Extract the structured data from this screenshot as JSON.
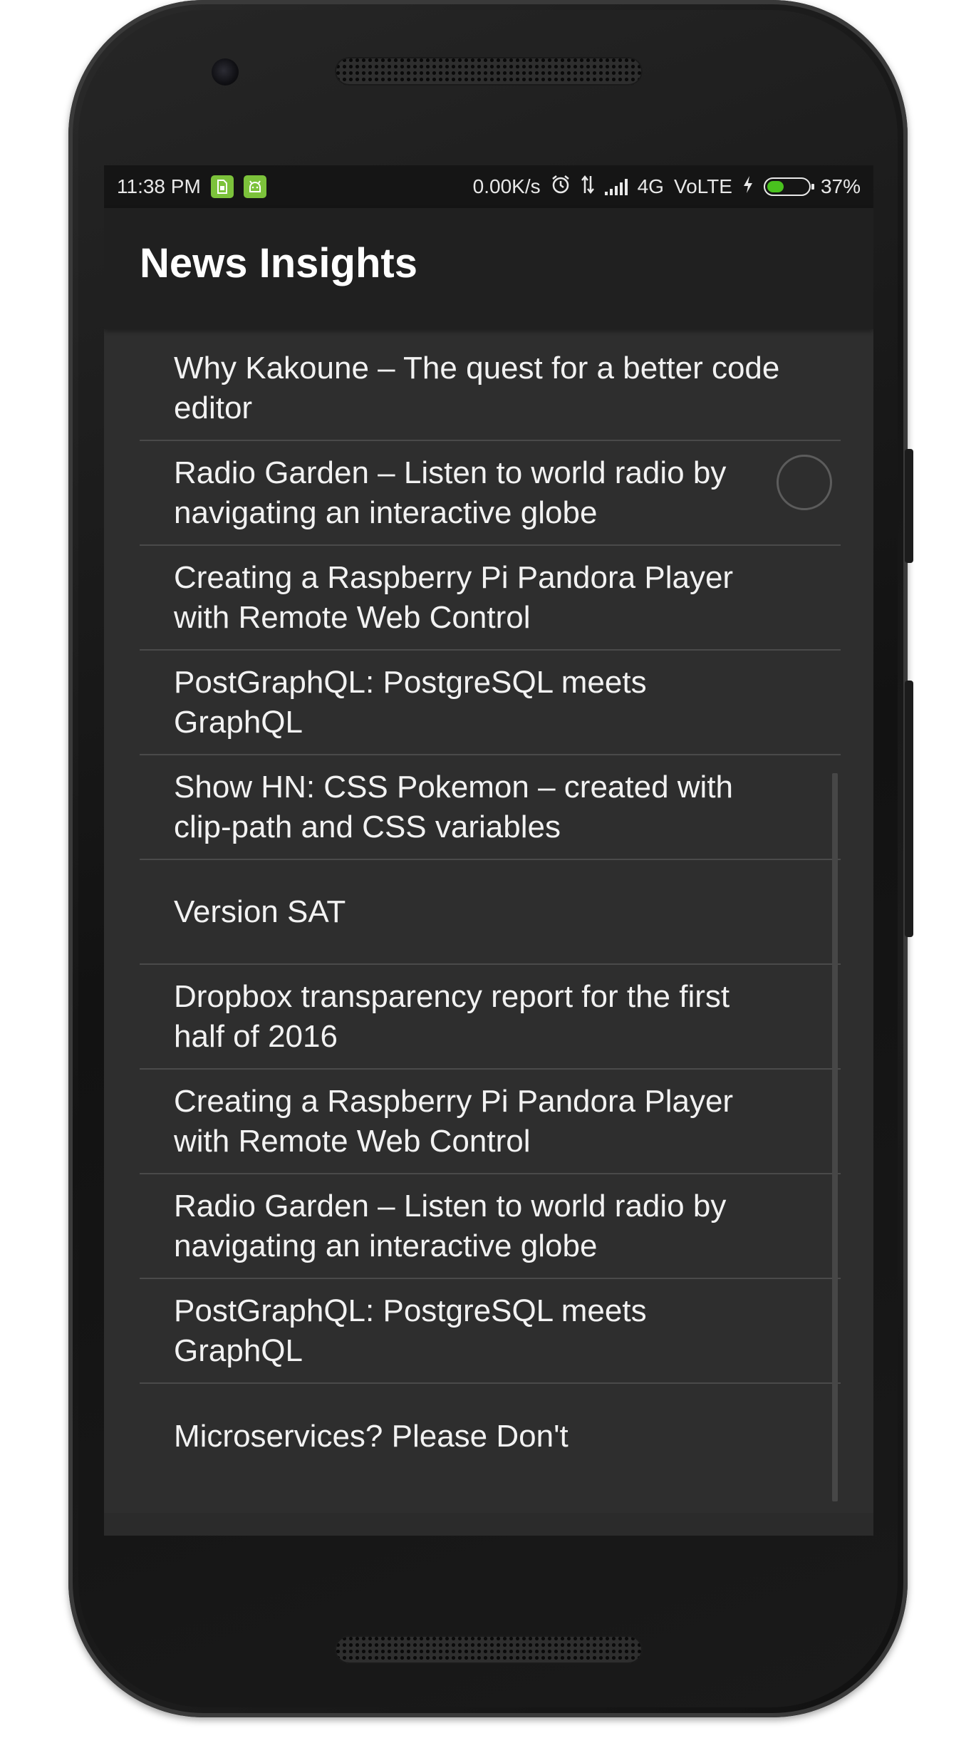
{
  "status_bar": {
    "time": "11:38 PM",
    "network_speed": "0.00K/s",
    "network_type": "4G",
    "volte": "VoLTE",
    "battery_percent": "37%",
    "battery_level": 0.37,
    "notification_icons": [
      "sim-card-icon",
      "android-icon"
    ],
    "status_icons": [
      "alarm-icon",
      "data-transfer-icon",
      "signal-icon",
      "charging-icon",
      "battery-icon"
    ]
  },
  "app_bar": {
    "title": "News Insights"
  },
  "news": {
    "items": [
      "Why Kakoune – The quest for a better code editor",
      "Radio Garden – Listen to world radio by navigating an interactive globe",
      "Creating a Raspberry Pi Pandora Player with Remote Web Control",
      "PostGraphQL: PostgreSQL meets GraphQL",
      "Show HN: CSS Pokemon – created with clip-path and CSS variables",
      "Version SAT",
      "Dropbox transparency report for the first half of 2016",
      "Creating a Raspberry Pi Pandora Player with Remote Web Control",
      "Radio Garden – Listen to world radio by navigating an interactive globe",
      "PostGraphQL: PostgreSQL meets GraphQL",
      "Microservices? Please Don't"
    ]
  },
  "colors": {
    "accent_green": "#7cc23b",
    "battery_fill": "#49c21e",
    "screen_background": "#2e2e2e",
    "app_bar_background": "#202020",
    "status_bar_background": "#151515"
  }
}
